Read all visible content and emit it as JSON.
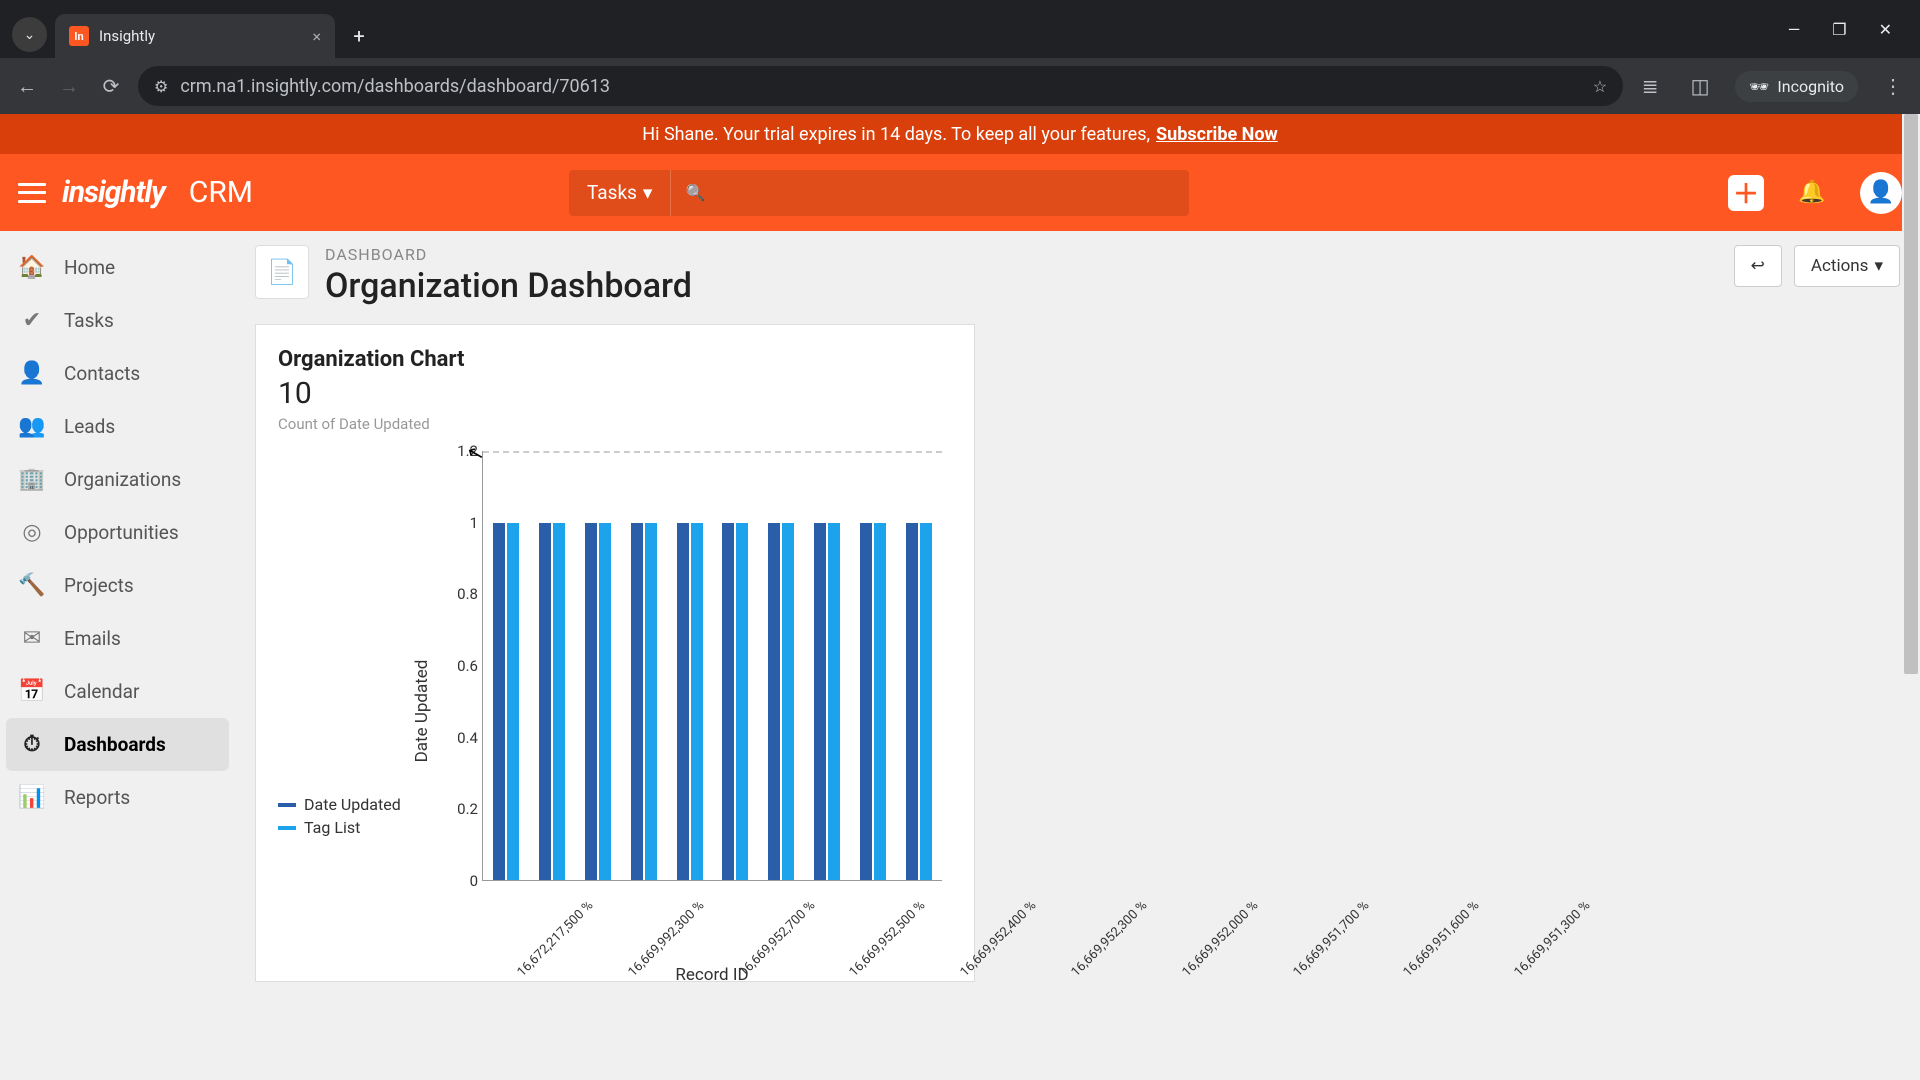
{
  "browser": {
    "tab_title": "Insightly",
    "tab_favicon": "In",
    "url": "crm.na1.insightly.com/dashboards/dashboard/70613",
    "incognito_label": "Incognito"
  },
  "banner": {
    "greeting": "Hi Shane. Your trial expires in 14 days. To keep all your features, ",
    "cta": "Subscribe Now"
  },
  "header": {
    "brand": "insightly",
    "app": "CRM",
    "search_scope": "Tasks"
  },
  "sidebar": {
    "items": [
      {
        "label": "Home",
        "icon": "🏠"
      },
      {
        "label": "Tasks",
        "icon": "✔"
      },
      {
        "label": "Contacts",
        "icon": "👤"
      },
      {
        "label": "Leads",
        "icon": "👥"
      },
      {
        "label": "Organizations",
        "icon": "🏢"
      },
      {
        "label": "Opportunities",
        "icon": "◎"
      },
      {
        "label": "Projects",
        "icon": "🔨"
      },
      {
        "label": "Emails",
        "icon": "✉"
      },
      {
        "label": "Calendar",
        "icon": "📅"
      },
      {
        "label": "Dashboards",
        "icon": "⏱"
      },
      {
        "label": "Reports",
        "icon": "📊"
      }
    ],
    "active_index": 9
  },
  "page": {
    "breadcrumb": "DASHBOARD",
    "title": "Organization Dashboard",
    "actions_label": "Actions"
  },
  "card": {
    "title": "Organization Chart",
    "big_value": "10",
    "subtitle": "Count of Date Updated"
  },
  "chart_data": {
    "type": "bar",
    "title": "Organization Chart",
    "ylabel": "Date Updated",
    "xlabel": "Record ID",
    "ylim": [
      0,
      1.2
    ],
    "y_ticks": [
      0,
      0.2,
      0.4,
      0.6,
      0.8,
      1,
      1.2
    ],
    "categories": [
      "16,672,217,500 %",
      "16,669,992,300 %",
      "16,669,952,700 %",
      "16,669,952,500 %",
      "16,669,952,400 %",
      "16,669,952,300 %",
      "16,669,952,000 %",
      "16,669,951,700 %",
      "16,669,951,600 %",
      "16,669,951,300 %"
    ],
    "series": [
      {
        "name": "Date Updated",
        "color": "#2b5ea8",
        "values": [
          1,
          1,
          1,
          1,
          1,
          1,
          1,
          1,
          1,
          1
        ]
      },
      {
        "name": "Tag List",
        "color": "#1ca3ec",
        "values": [
          1,
          1,
          1,
          1,
          1,
          1,
          1,
          1,
          1,
          1
        ]
      }
    ]
  }
}
